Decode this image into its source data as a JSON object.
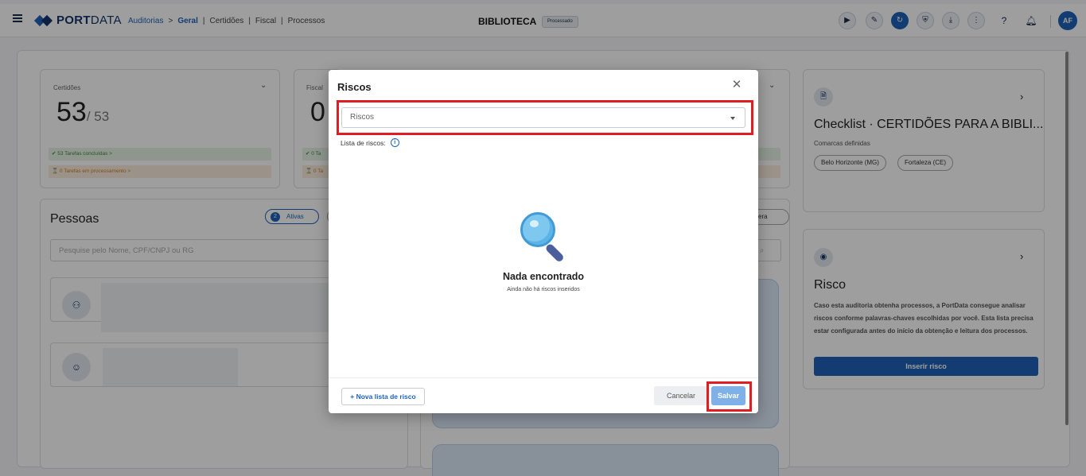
{
  "header": {
    "brand_bold": "PORT",
    "brand_light": "DATA",
    "breadcrumb": {
      "auditorias": "Auditorias",
      "sep": ">",
      "geral": "Geral",
      "pipe": "|",
      "certidoes": "Certidões",
      "fiscal": "Fiscal",
      "processos": "Processos"
    },
    "title": "BIBLIOTECA",
    "status_badge": "Processado",
    "user_initials": "AF"
  },
  "certidoes_card": {
    "label": "Certidões",
    "count": "53",
    "total": "/ 53",
    "tarefas_concluidas": "✔ 53 Tarefas concluídas  >",
    "tarefas_processamento": "⌛ 0 Tarefas em processamento  >"
  },
  "fiscal_card": {
    "label": "Fiscal",
    "count": "0",
    "tarefas_concluidas": "✔ 0 Ta",
    "tarefas_processamento": "⌛ 0 Ta"
  },
  "pessoas": {
    "title": "Pessoas",
    "ativas_count": "2",
    "ativas_label": "Ativas",
    "search_placeholder": "Pesquise pelo Nome, CPF/CNPJ ou RG"
  },
  "peer_panel": {
    "pill_partial": "era"
  },
  "checklist_card": {
    "title": "Checklist · CERTIDÕES PARA A BIBLI...",
    "comarcas_label": "Comarcas definidas",
    "chips": [
      "Belo Horizonte (MG)",
      "Fortaleza (CE)"
    ]
  },
  "risco_card": {
    "title": "Risco",
    "description": "Caso esta auditoria obtenha processos, a PortData consegue analisar riscos conforme palavras-chaves escolhidas por você. Esta lista precisa estar configurada antes do início da obtenção e leitura dos processos.",
    "button": "Inserir risco"
  },
  "modal": {
    "title": "Riscos",
    "dropdown_placeholder": "Riscos",
    "list_label": "Lista de riscos:",
    "empty_title": "Nada encontrado",
    "empty_subtitle": "Ainda não há riscos inseridos",
    "new_list_button": "+ Nova lista de risco",
    "cancel_button": "Cancelar",
    "save_button": "Salvar"
  },
  "colors": {
    "primary": "#1f63b8",
    "brand_dark": "#12346b",
    "highlight": "#e11d24"
  }
}
